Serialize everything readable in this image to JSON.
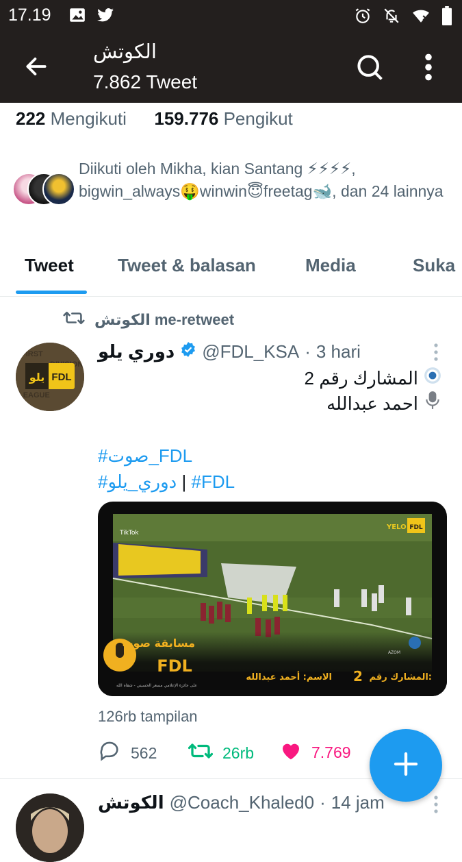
{
  "status_bar": {
    "time": "17.19"
  },
  "header": {
    "title": "الكوتش",
    "subtitle": "7.862 Tweet"
  },
  "profile": {
    "following_count": "222",
    "following_label": "Mengikuti",
    "followers_count": "159.776",
    "followers_label": "Pengikut",
    "followed_by_text": "Diikuti oleh Mikha, kian Santang ⚡⚡⚡⚡, bigwin_always🤑winwin😇freetag🐋, dan 24 lainnya"
  },
  "tabs": [
    {
      "label": "Tweet"
    },
    {
      "label": "Tweet & balasan"
    },
    {
      "label": "Media"
    },
    {
      "label": "Suka"
    }
  ],
  "tweet": {
    "retweet_label": "الكوتش me-retweet",
    "author_name": "دوري يلو",
    "author_handle": "@FDL_KSA",
    "time_sep": "·",
    "time": "3 hari",
    "body_line1": "المشارك رقم 2",
    "body_line2": "احمد عبدالله",
    "hashtag1": "#صوت_FDL",
    "hashtag2": "#دوري_يلو",
    "hashtag_sep": "|",
    "hashtag3": "#FDL",
    "video": {
      "tiktok_label": "TikTok",
      "brand_label": "YELO",
      "banner_title_ar": "مسابقة صوت",
      "banner_fdl": "FDL",
      "banner_sub": "على جائزة الإعلامي مسعر الحسيني - شقاه الله",
      "participant_label": "المشارك رقم:",
      "participant_number": "2",
      "name_label": "الاسم: أحمد عبدالله",
      "azom_label": "AZOM"
    },
    "views": "126rb tampilan",
    "replies": "562",
    "retweets": "26rb",
    "likes": "7.769"
  },
  "next_tweet": {
    "author_name": "الكوتش",
    "author_handle": "@Coach_Khaled0",
    "time_sep": "·",
    "time": "14 jam"
  },
  "colors": {
    "header_bg": "#231f1e",
    "accent": "#1d9bf0",
    "retweet_green": "#00ba7c",
    "like_pink": "#f91880",
    "secondary_text": "#536471"
  }
}
